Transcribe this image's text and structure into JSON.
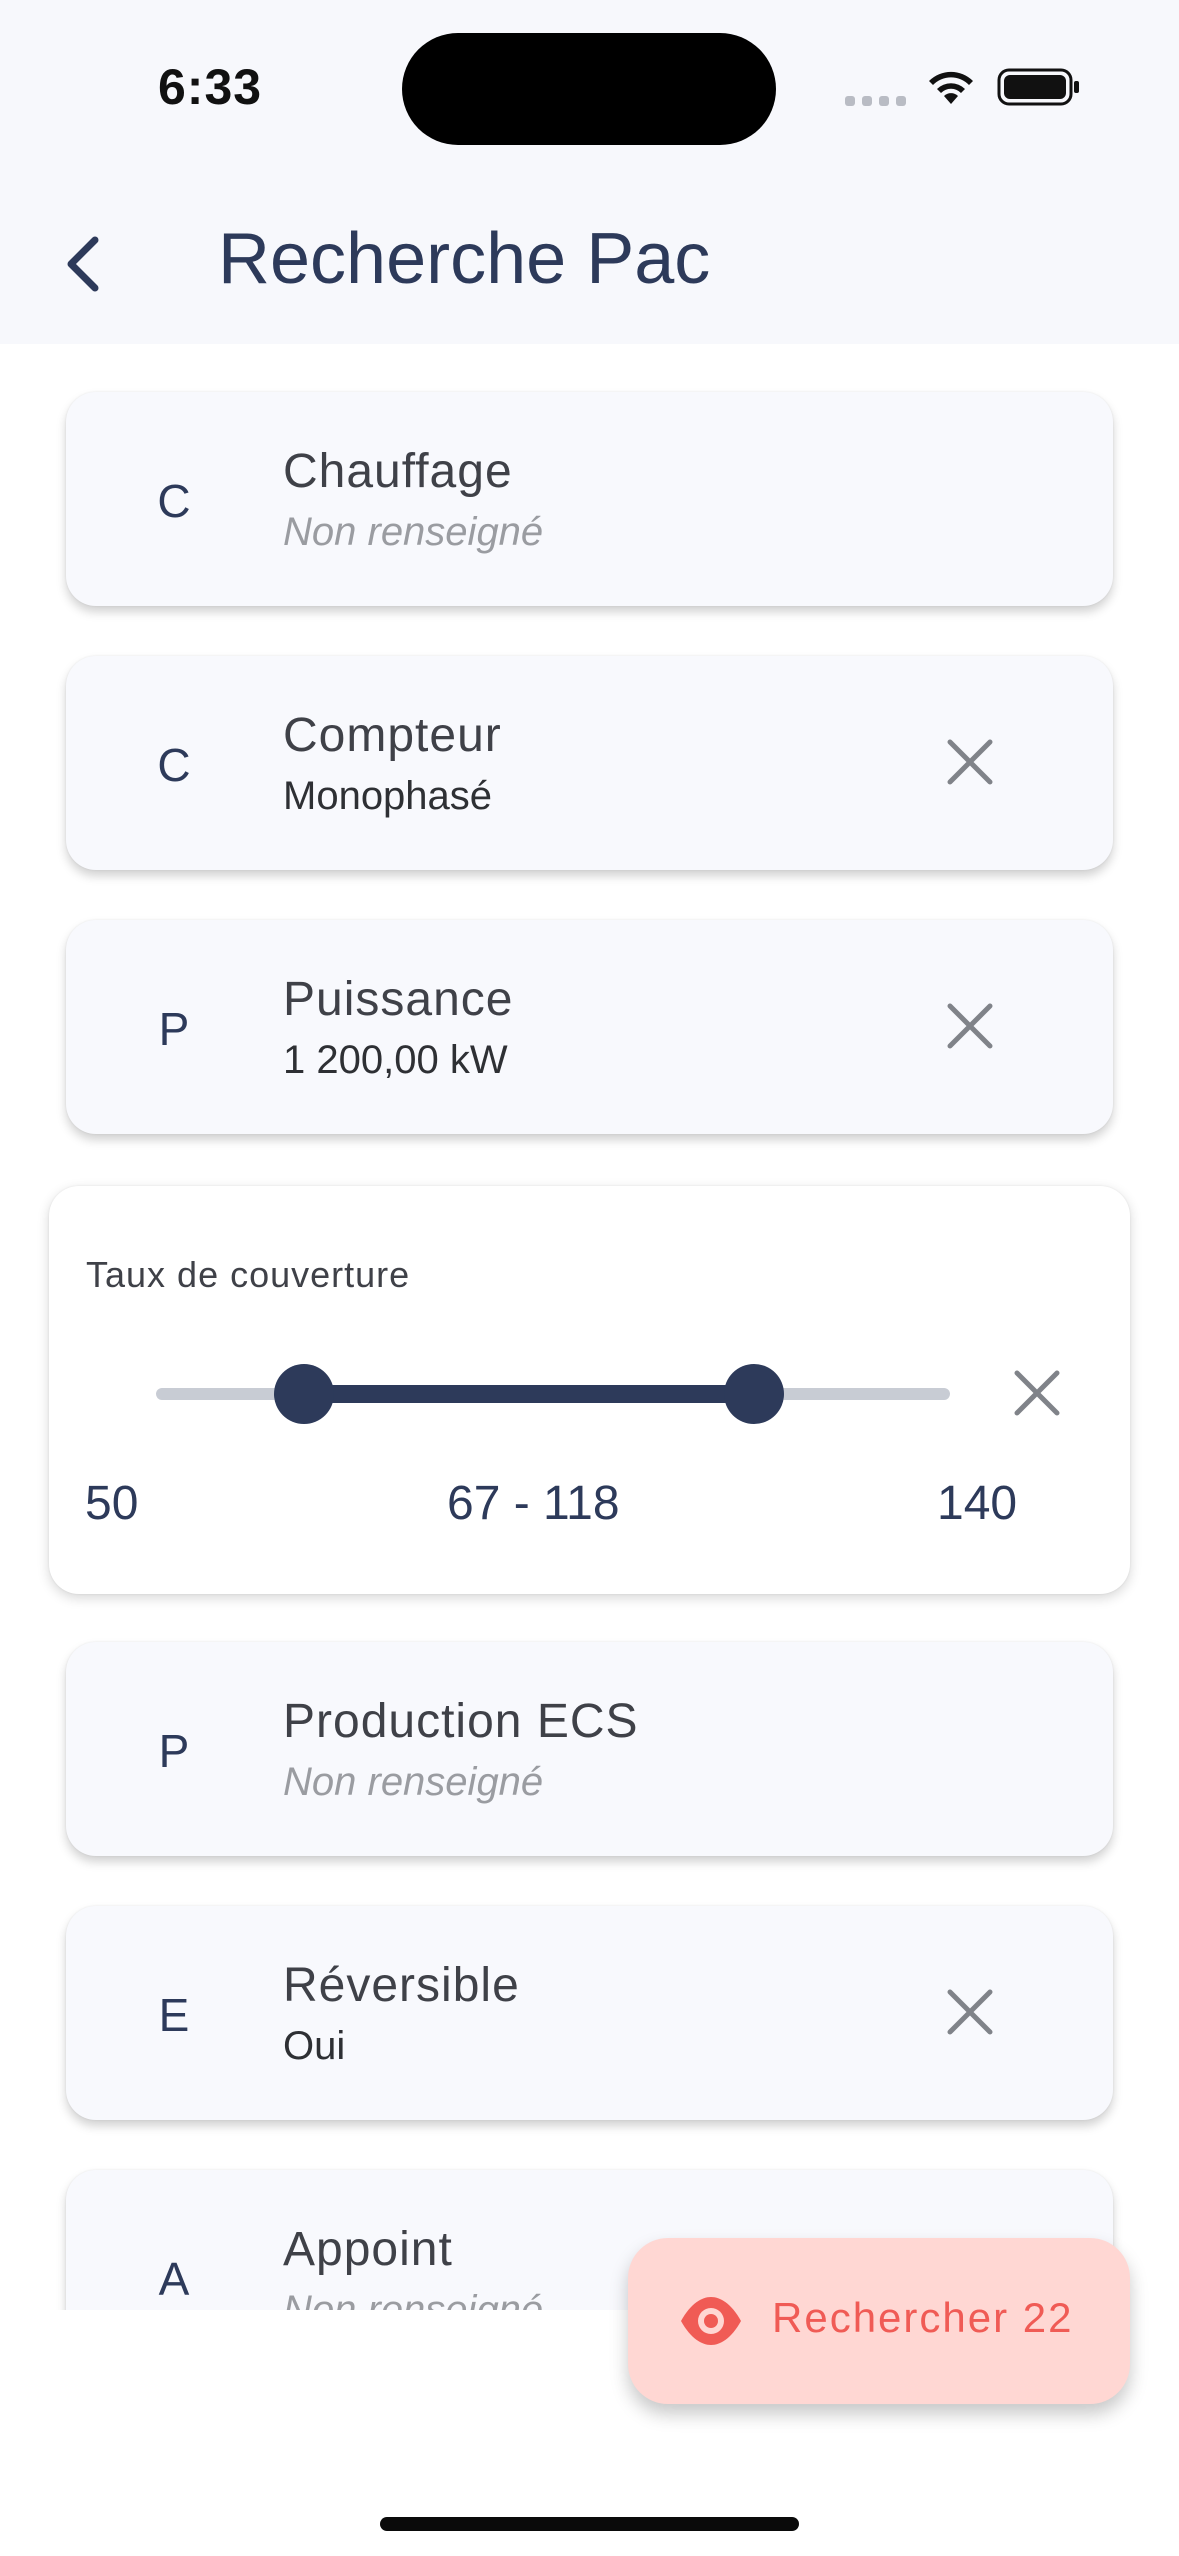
{
  "status": {
    "time": "6:33"
  },
  "header": {
    "title": "Recherche Pac"
  },
  "filters": [
    {
      "initial": "C",
      "label": "Chauffage",
      "value": "Non renseigné",
      "empty": true
    },
    {
      "initial": "C",
      "label": "Compteur",
      "value": "Monophasé",
      "empty": false
    },
    {
      "initial": "P",
      "label": "Puissance",
      "value": "1 200,00 kW",
      "empty": false
    },
    {
      "initial": "P",
      "label": "Production ECS",
      "value": "Non renseigné",
      "empty": true
    },
    {
      "initial": "E",
      "label": "Réversible",
      "value": "Oui",
      "empty": false
    },
    {
      "initial": "A",
      "label": "Appoint",
      "value": "Non renseigné",
      "empty": true
    }
  ],
  "coverage": {
    "label": "Taux de couverture",
    "min": "50",
    "max": "140",
    "range_text": "67 - 118",
    "low": 67,
    "high": 118
  },
  "fab": {
    "label": "Rechercher 22",
    "color": "#f05b55",
    "background": "#ffd7d3"
  },
  "colors": {
    "primary": "#2d3a5a",
    "card": "#f8f9fd"
  }
}
